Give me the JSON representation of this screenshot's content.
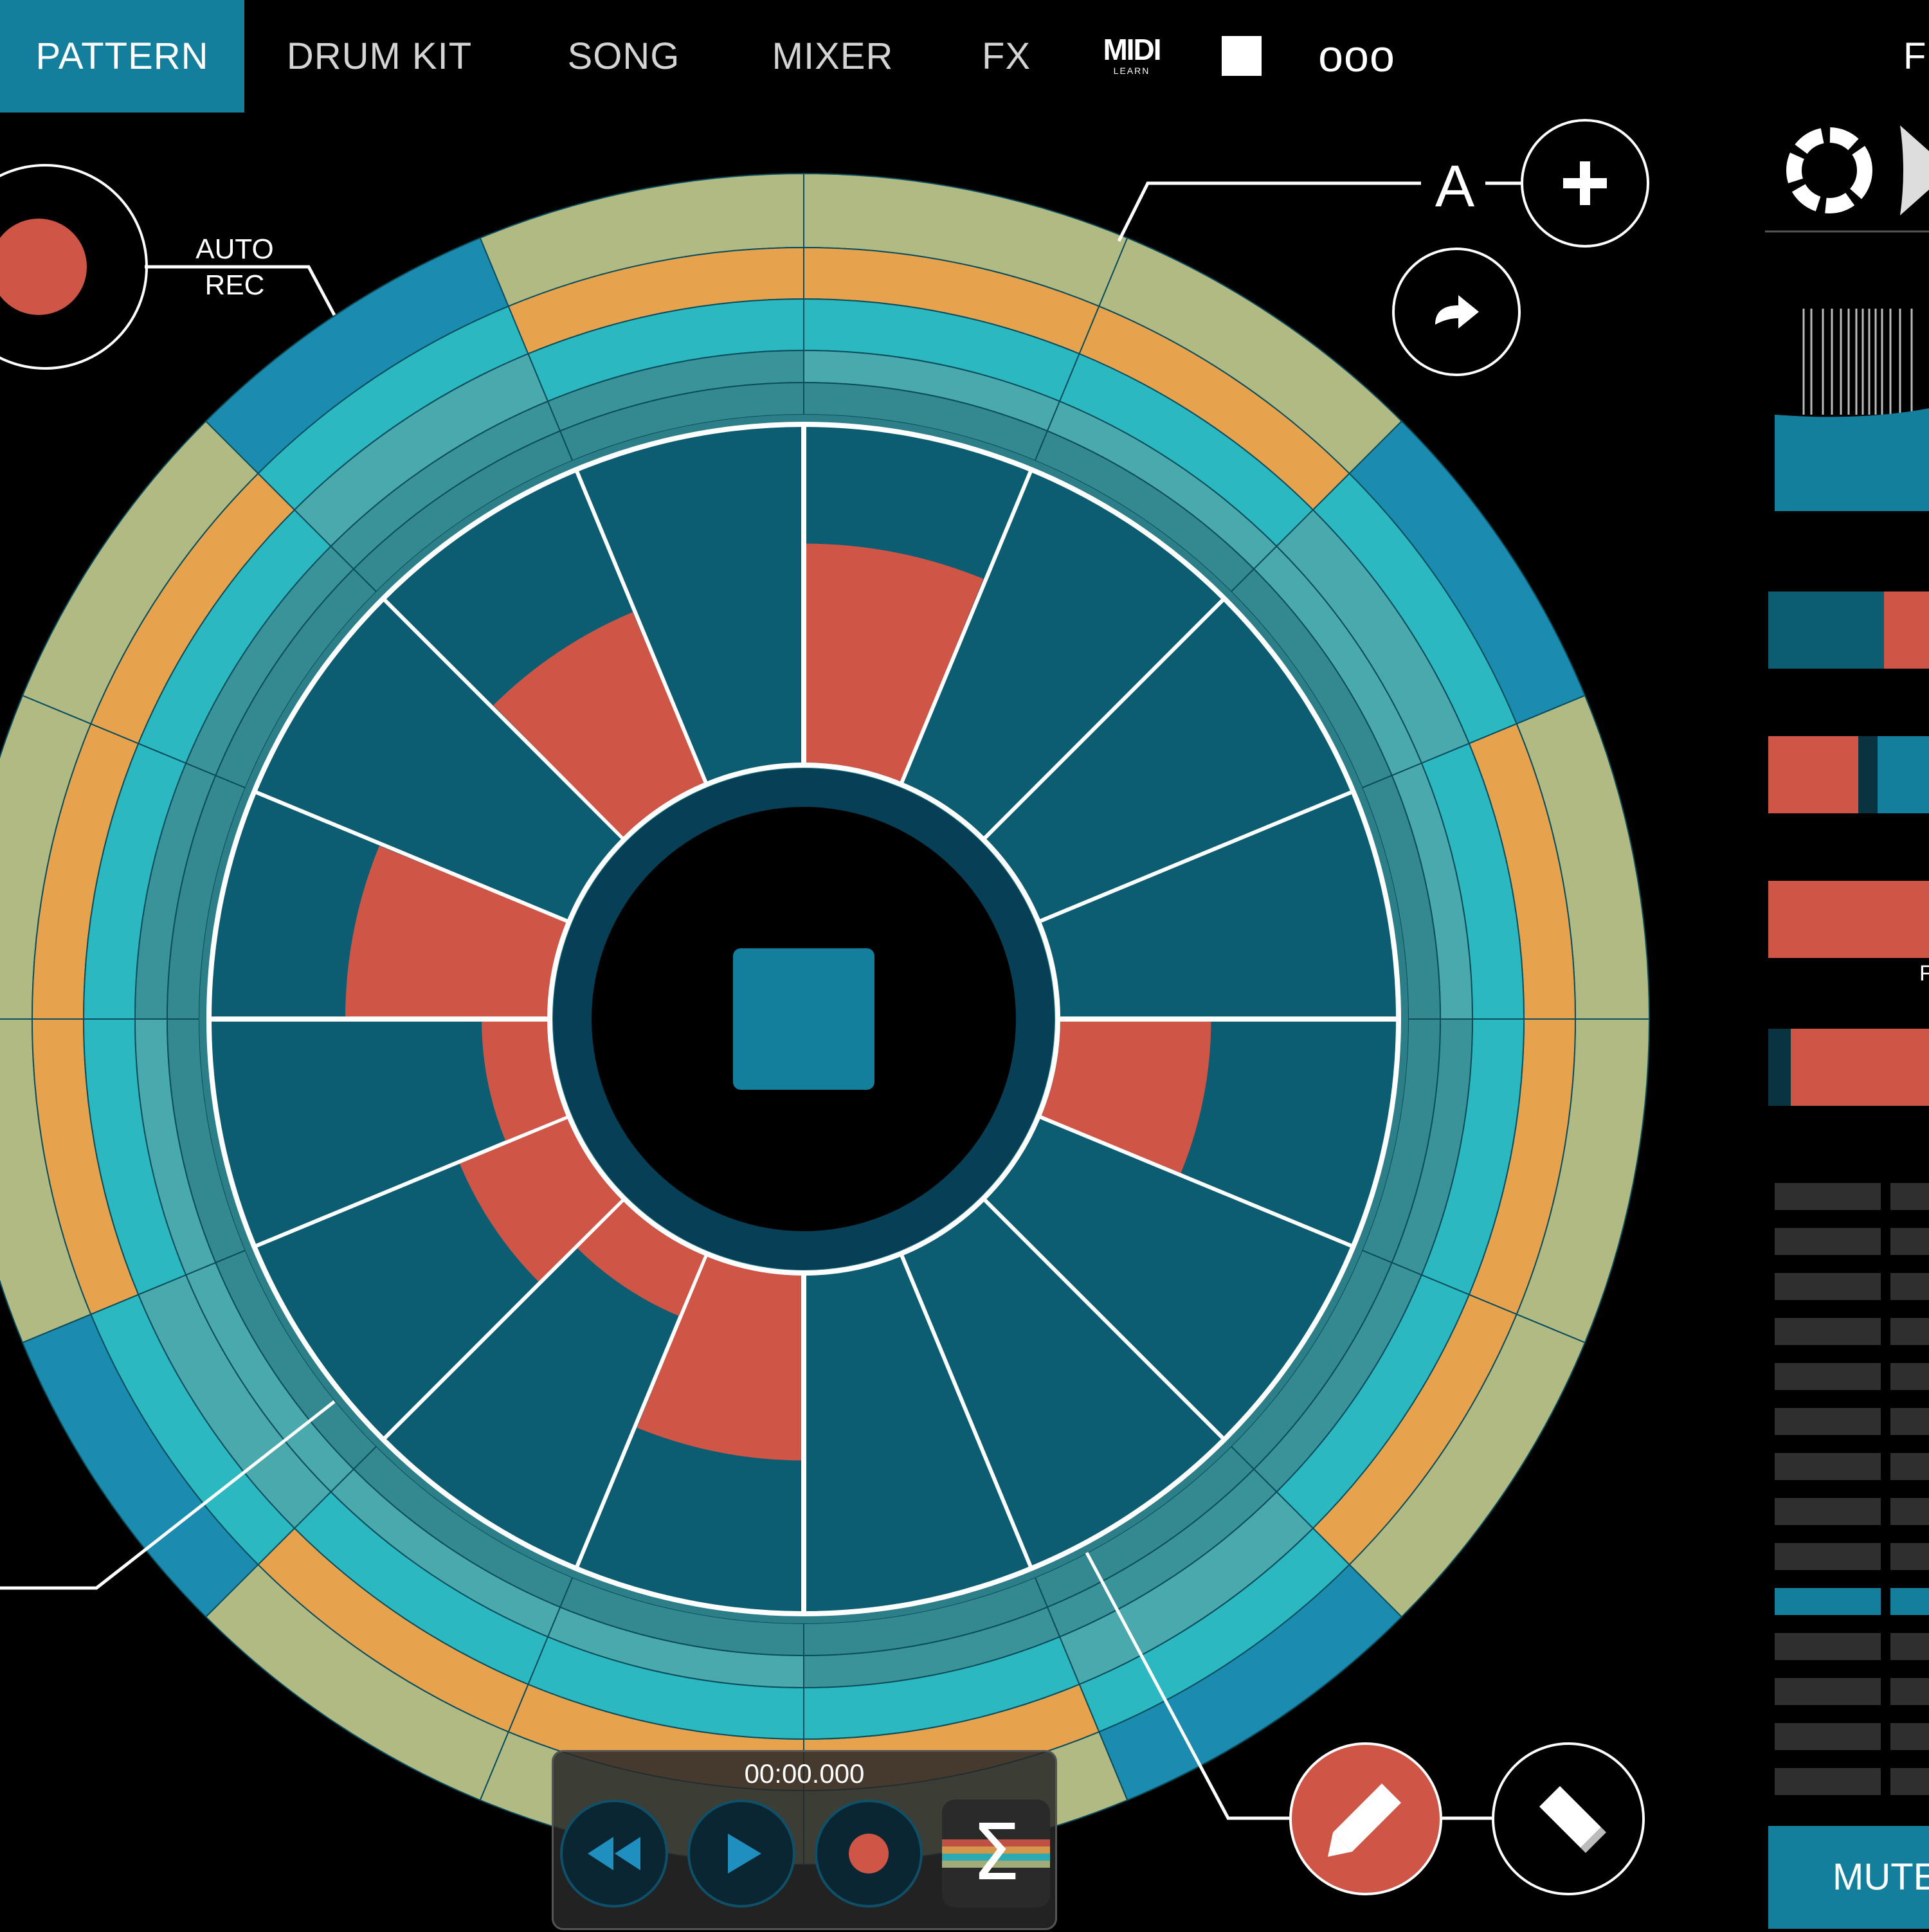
{
  "nav": {
    "tabs": [
      "PATTERN",
      "DRUM KIT",
      "SONG",
      "MIXER",
      "FX"
    ],
    "midi_main": "MIDI",
    "midi_sub": "LEARN",
    "more": "ooo",
    "cut_off_right": "F"
  },
  "record": {
    "auto_rec_line1": "AUTO",
    "auto_rec_line2": "REC"
  },
  "pattern": {
    "label": "A"
  },
  "transport": {
    "time": "00:00.000",
    "sum_symbol": "Σ"
  },
  "right_panel": {
    "mute_label": "MUTE",
    "partial_label": "F"
  },
  "colors": {
    "accent": "#137f9d",
    "step_off": "#0d5d72",
    "step_on": "#cf5547",
    "ring_sage": "#b0ba82",
    "ring_orange": "#e6a24d",
    "ring_teal": "#2bb8c0",
    "ring_blue": "#1b8bb0"
  },
  "sequencer": {
    "steps": 16,
    "active_steps": [
      {
        "step": 0,
        "level": 0.65
      },
      {
        "step": 4,
        "level": 0.45
      },
      {
        "step": 8,
        "level": 0.55
      },
      {
        "step": 9,
        "level": 0.2
      },
      {
        "step": 10,
        "level": 0.35
      },
      {
        "step": 11,
        "level": 0.2
      },
      {
        "step": 12,
        "level": 0.6
      },
      {
        "step": 14,
        "level": 0.55
      }
    ]
  }
}
